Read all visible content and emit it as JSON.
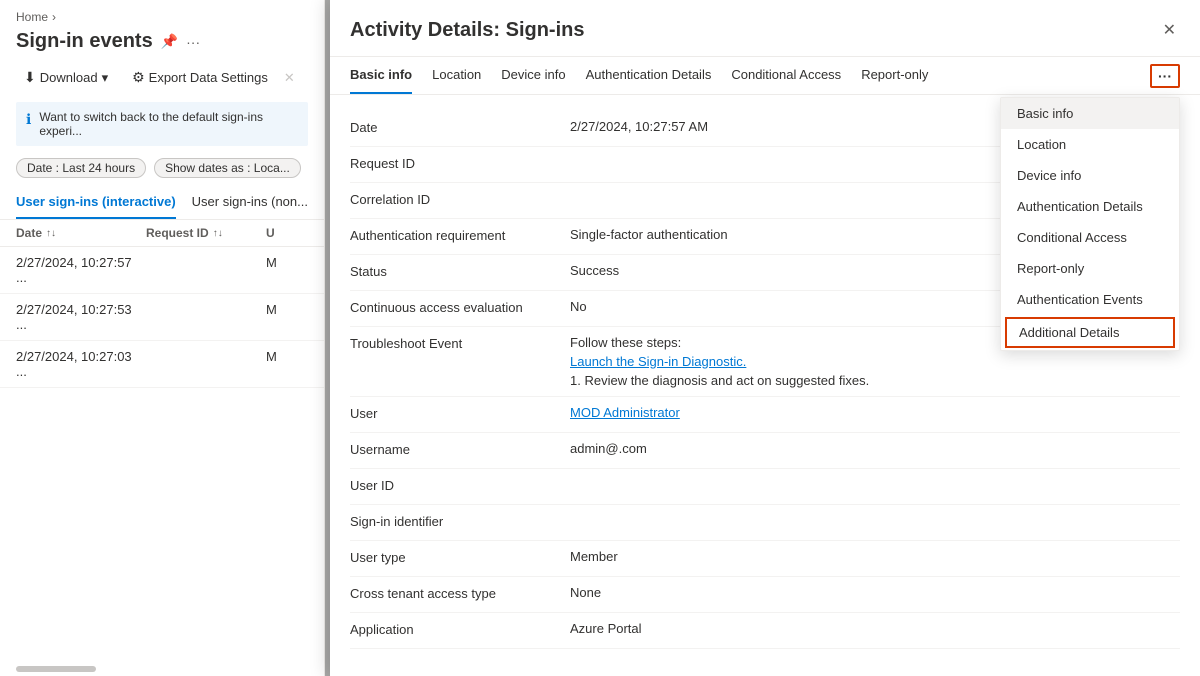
{
  "breadcrumb": {
    "home": "Home",
    "arrow": "›"
  },
  "left_panel": {
    "title": "Sign-in events",
    "toolbar": {
      "download": "Download",
      "export": "Export Data Settings"
    },
    "banner": {
      "text": "Want to switch back to the default sign-ins experi..."
    },
    "filters": [
      {
        "label": "Date : Last 24 hours"
      },
      {
        "label": "Show dates as : Loca..."
      }
    ],
    "tabs": [
      {
        "label": "User sign-ins (interactive)",
        "active": true
      },
      {
        "label": "User sign-ins (non...",
        "active": false
      }
    ],
    "table": {
      "columns": [
        "Date",
        "Request ID",
        "U"
      ],
      "rows": [
        {
          "date": "2/27/2024, 10:27:57 ...",
          "reqid": "",
          "user": "M"
        },
        {
          "date": "2/27/2024, 10:27:53 ...",
          "reqid": "",
          "user": "M"
        },
        {
          "date": "2/27/2024, 10:27:03 ...",
          "reqid": "",
          "user": "M"
        }
      ]
    }
  },
  "modal": {
    "title": "Activity Details: Sign-ins",
    "close_icon": "✕",
    "tabs": [
      {
        "label": "Basic info",
        "active": true
      },
      {
        "label": "Location"
      },
      {
        "label": "Device info"
      },
      {
        "label": "Authentication Details"
      },
      {
        "label": "Conditional Access"
      },
      {
        "label": "Report-only"
      }
    ],
    "more_btn_label": "···",
    "dropdown": {
      "items": [
        {
          "label": "Basic info",
          "active": true,
          "highlighted": false
        },
        {
          "label": "Location",
          "active": false,
          "highlighted": false
        },
        {
          "label": "Device info",
          "active": false,
          "highlighted": false
        },
        {
          "label": "Authentication Details",
          "active": false,
          "highlighted": false
        },
        {
          "label": "Conditional Access",
          "active": false,
          "highlighted": false
        },
        {
          "label": "Report-only",
          "active": false,
          "highlighted": false
        },
        {
          "label": "Authentication Events",
          "active": false,
          "highlighted": false
        },
        {
          "label": "Additional Details",
          "active": false,
          "highlighted": true
        }
      ]
    },
    "details": [
      {
        "label": "Date",
        "value": "2/27/2024, 10:27:57 AM",
        "type": "text"
      },
      {
        "label": "Request ID",
        "value": "",
        "type": "text"
      },
      {
        "label": "Correlation ID",
        "value": "",
        "type": "text"
      },
      {
        "label": "Authentication requirement",
        "value": "Single-factor authentication",
        "type": "text"
      },
      {
        "label": "Status",
        "value": "Success",
        "type": "text"
      },
      {
        "label": "Continuous access evaluation",
        "value": "No",
        "type": "text"
      },
      {
        "label": "Troubleshoot Event",
        "type": "troubleshoot",
        "steps": "Follow these steps:",
        "link": "Launch the Sign-in Diagnostic.",
        "step1": "1. Review the diagnosis and act on suggested fixes."
      },
      {
        "label": "User",
        "value": "MOD Administrator",
        "type": "link"
      },
      {
        "label": "Username",
        "value": "admin@.com",
        "type": "text"
      },
      {
        "label": "User ID",
        "value": "",
        "type": "text"
      },
      {
        "label": "Sign-in identifier",
        "value": "",
        "type": "text"
      },
      {
        "label": "User type",
        "value": "Member",
        "type": "text"
      },
      {
        "label": "Cross tenant access type",
        "value": "None",
        "type": "text"
      },
      {
        "label": "Application",
        "value": "Azure Portal",
        "type": "text"
      }
    ]
  }
}
